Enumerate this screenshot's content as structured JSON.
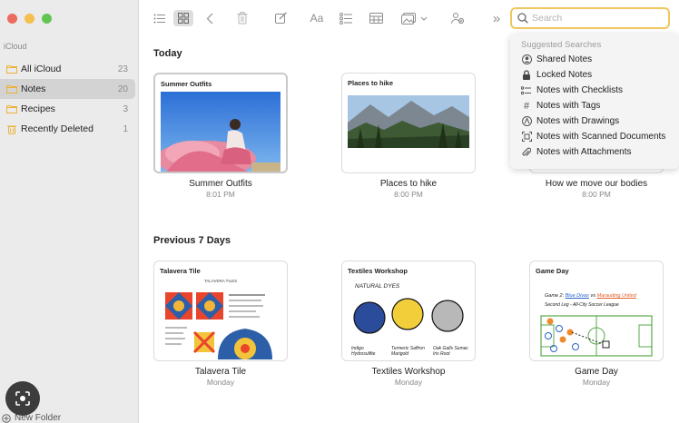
{
  "sidebar": {
    "section_label": "iCloud",
    "folders": [
      {
        "label": "All iCloud",
        "count": "23"
      },
      {
        "label": "Notes",
        "count": "20"
      },
      {
        "label": "Recipes",
        "count": "3"
      },
      {
        "label": "Recently Deleted",
        "count": "1"
      }
    ],
    "new_folder_label": "New Folder"
  },
  "toolbar": {
    "search_placeholder": "Search",
    "text_format_label": "Aa",
    "overflow_label": "»",
    "icons": [
      "list-view-icon",
      "gallery-view-icon",
      "back-icon",
      "trash-icon",
      "compose-icon",
      "text-format-icon",
      "checklist-icon",
      "table-icon",
      "media-icon",
      "collaborate-icon",
      "overflow-icon",
      "search-icon"
    ]
  },
  "main": {
    "groups": [
      {
        "title": "Today",
        "notes": [
          {
            "thumb_title": "Summer Outfits",
            "name": "Summer Outfits",
            "date": "8:01 PM"
          },
          {
            "thumb_title": "Places to hike",
            "name": "Places to hike",
            "date": "8:00 PM"
          },
          {
            "thumb_title": "",
            "name": "How we move our bodies",
            "date": "8:00 PM"
          }
        ]
      },
      {
        "title": "Previous 7 Days",
        "notes": [
          {
            "thumb_title": "Talavera Tile",
            "name": "Talavera Tile",
            "date": "Monday"
          },
          {
            "thumb_title": "Textiles Workshop",
            "name": "Textiles Workshop",
            "date": "Monday"
          },
          {
            "thumb_title": "Game Day",
            "name": "Game Day",
            "date": "Monday"
          }
        ]
      }
    ],
    "textiles_sketch": {
      "heading": "NATURAL DYES",
      "captions": [
        "Indigo Hydrosulfite",
        "Turmeric Saffron Marigold",
        "Oak Galls Sumac Iris Root"
      ]
    },
    "gameday_sketch": {
      "line1": "Game 2:",
      "team_a": "Blue Divas",
      "vs": "vs",
      "team_b": "Marauding United",
      "line2": "Second Leg - All-City Soccer League"
    },
    "talavera_sketch": {
      "header": "TALAVERA TILES"
    }
  },
  "suggestions": {
    "heading": "Suggested Searches",
    "items": [
      {
        "label": "Shared Notes",
        "icon": "shared-icon"
      },
      {
        "label": "Locked Notes",
        "icon": "lock-icon"
      },
      {
        "label": "Notes with Checklists",
        "icon": "checklist-icon"
      },
      {
        "label": "Notes with Tags",
        "icon": "tag-icon"
      },
      {
        "label": "Notes with Drawings",
        "icon": "drawing-icon"
      },
      {
        "label": "Notes with Scanned Documents",
        "icon": "scan-icon"
      },
      {
        "label": "Notes with Attachments",
        "icon": "paperclip-icon"
      }
    ]
  },
  "colors": {
    "accent_yellow": "#f0c75e",
    "folder_icon": "#e9b33a",
    "trash_icon": "#e9b33a"
  }
}
